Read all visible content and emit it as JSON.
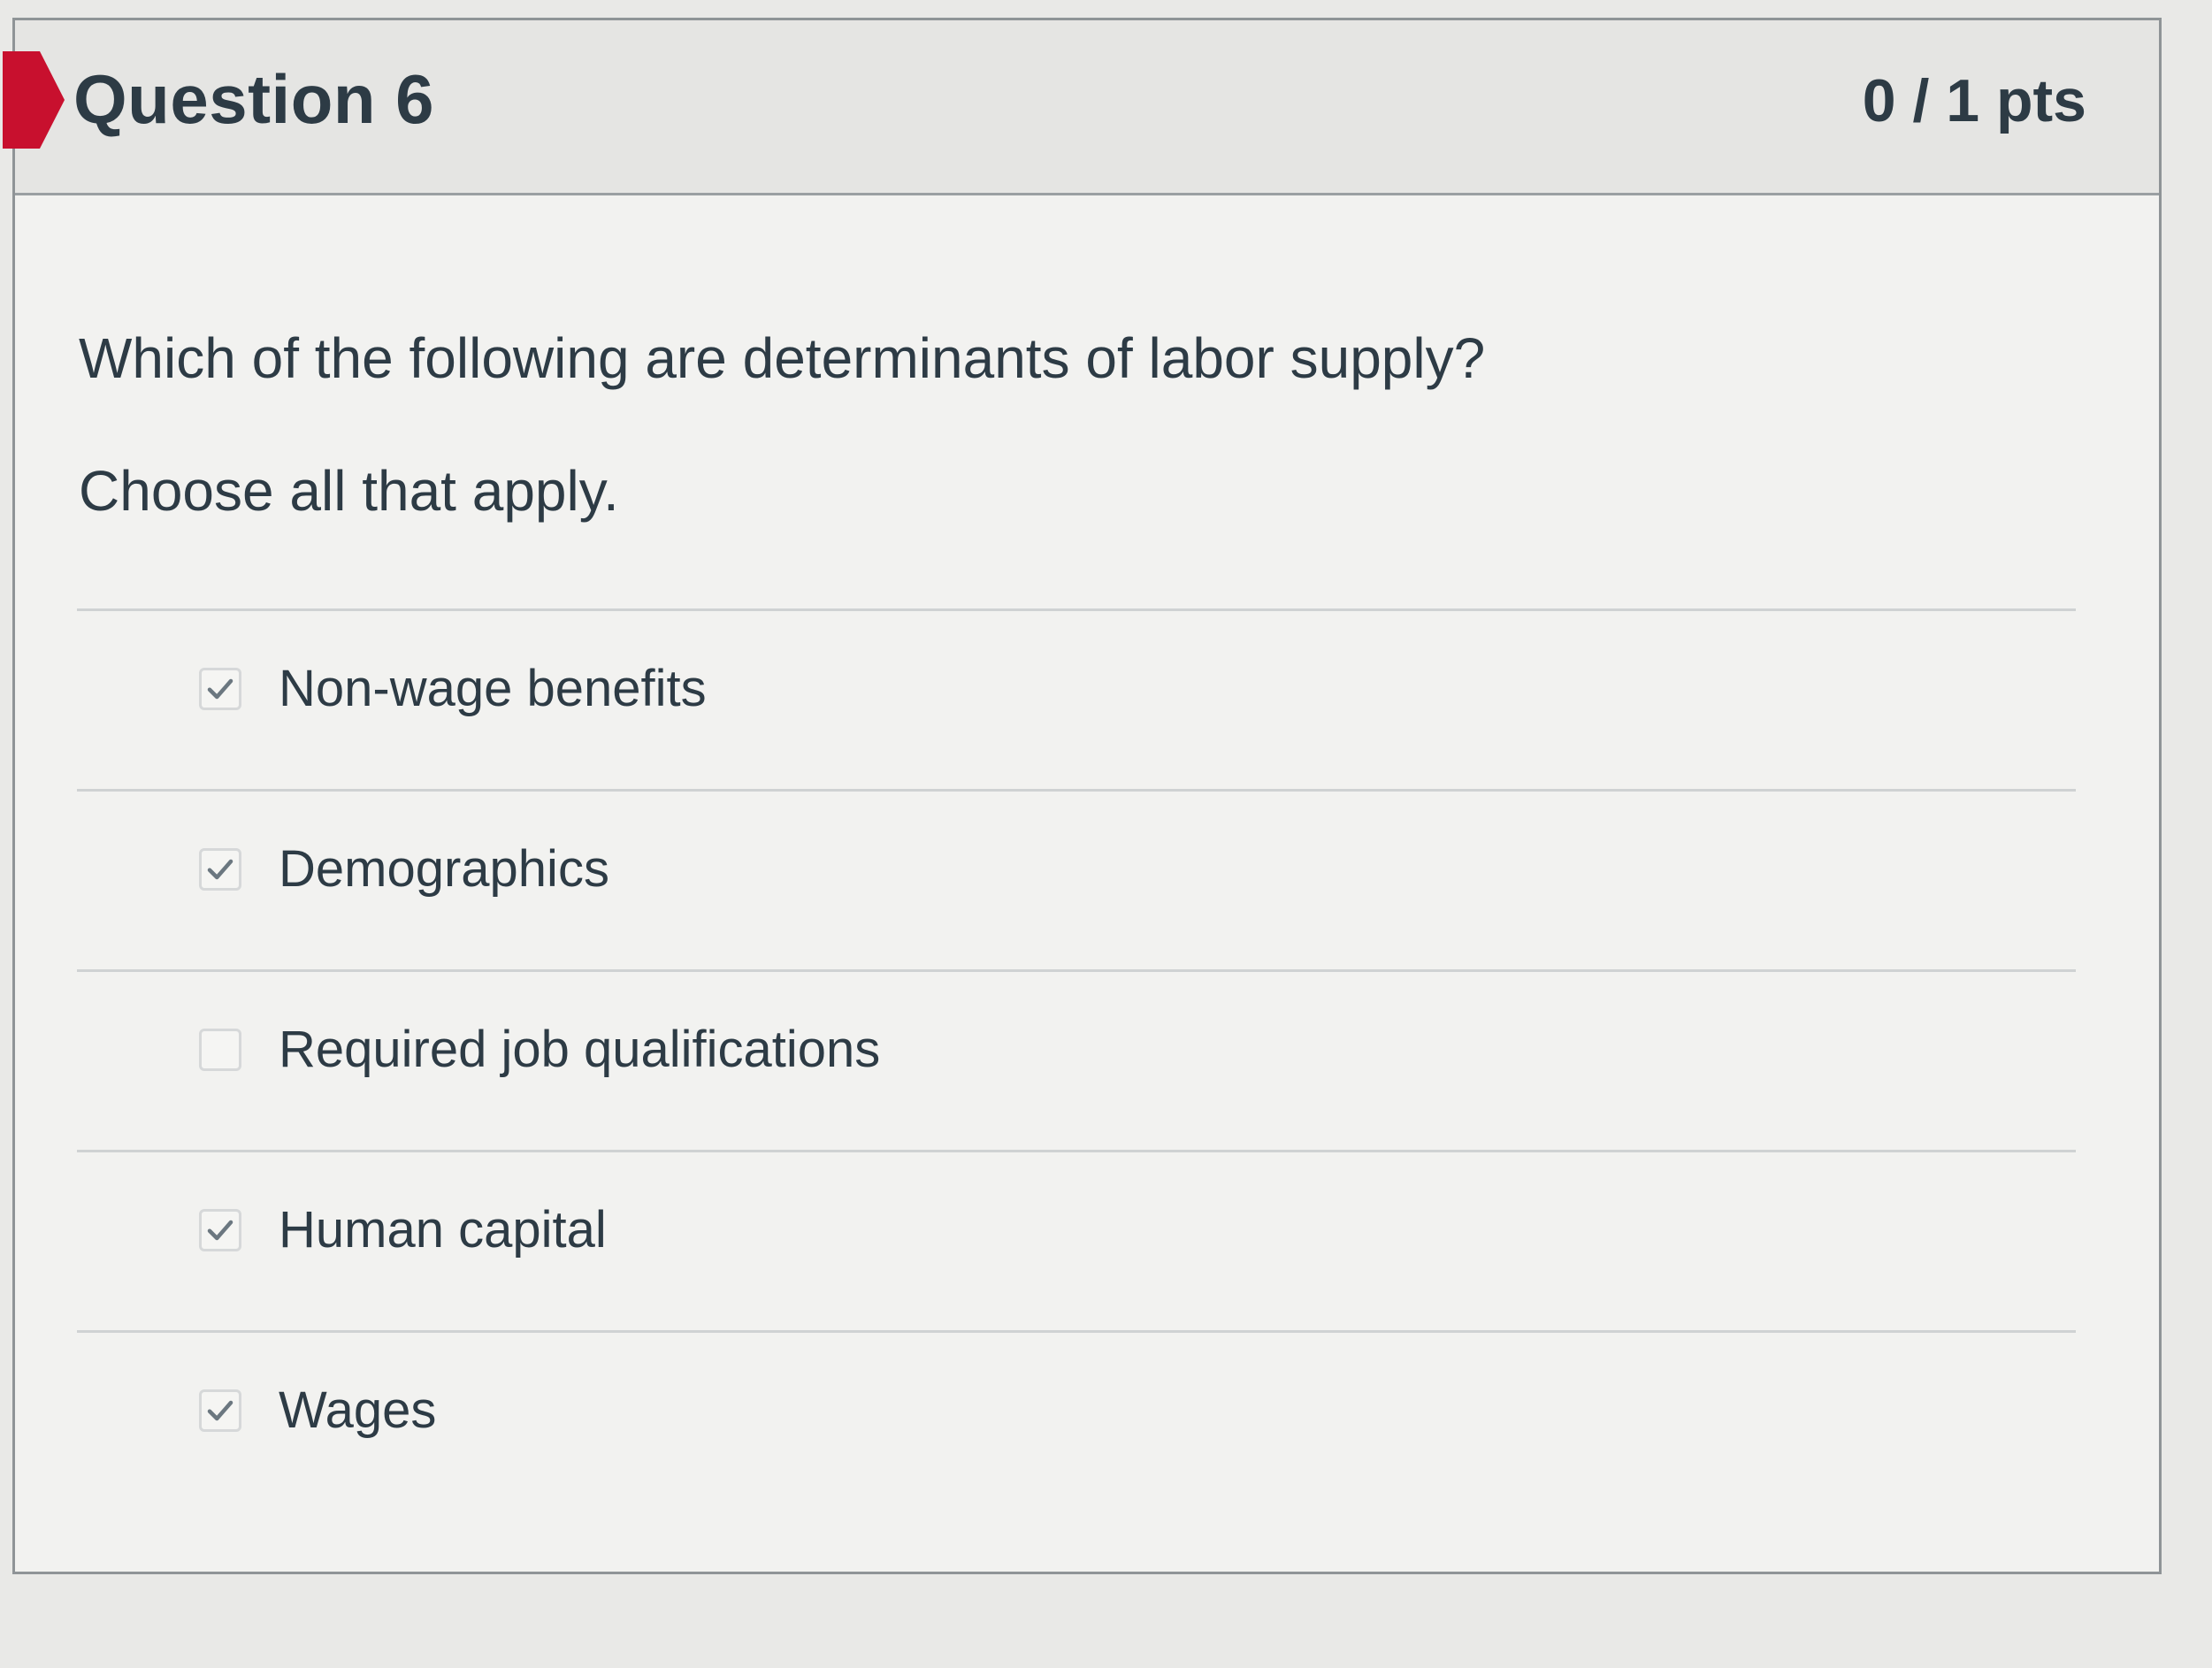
{
  "question": {
    "title": "Question 6",
    "points": "0 / 1 pts",
    "text": "Which of the following are determinants of labor supply?",
    "instruction": "Choose all that apply.",
    "answers": [
      {
        "label": "Non-wage benefits",
        "checked": true
      },
      {
        "label": "Demographics",
        "checked": true
      },
      {
        "label": "Required job qualifications",
        "checked": false
      },
      {
        "label": "Human capital",
        "checked": true
      },
      {
        "label": "Wages",
        "checked": true
      }
    ]
  },
  "colors": {
    "incorrect_flag": "#c8102e",
    "text": "#2d3b45",
    "check": "#6b7780"
  },
  "icons": {
    "checked": "check-icon",
    "flag": "incorrect-flag-icon"
  }
}
